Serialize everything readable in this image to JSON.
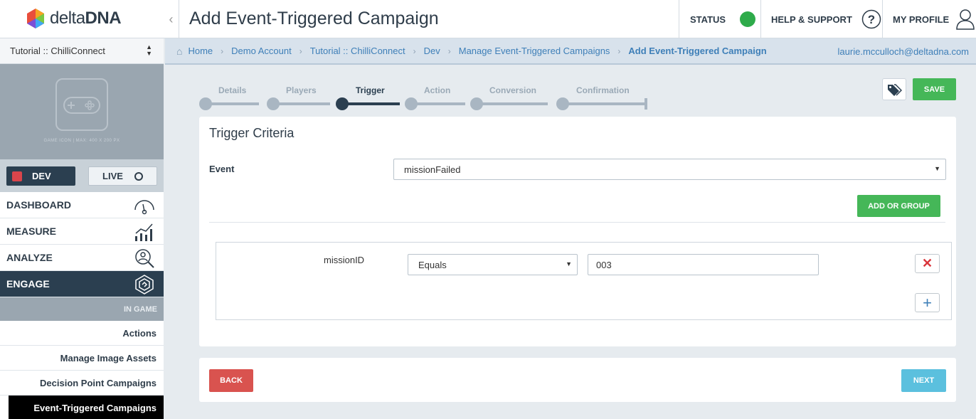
{
  "app": {
    "logo_bold": "delta",
    "logo_brand": "DNA",
    "page_title": "Add Event-Triggered Campaign"
  },
  "header": {
    "status_label": "STATUS",
    "status_color": "#2eab4a",
    "help_label": "HELP & SUPPORT",
    "profile_label": "MY PROFILE"
  },
  "sidebar": {
    "game_select": "Tutorial :: ChilliConnect",
    "game_icon_caption": "GAME ICON  |  MAX: 400 X 200 PX",
    "env_dev": "DEV",
    "env_live": "LIVE",
    "nav": [
      {
        "label": "DASHBOARD",
        "icon": "gauge-icon"
      },
      {
        "label": "MEASURE",
        "icon": "chart-icon"
      },
      {
        "label": "ANALYZE",
        "icon": "magnifier-user-icon"
      },
      {
        "label": "ENGAGE",
        "icon": "engage-icon"
      }
    ],
    "sub_header": "IN GAME",
    "sub_items": [
      "Actions",
      "Manage Image Assets",
      "Decision Point Campaigns",
      "Event-Triggered Campaigns"
    ]
  },
  "breadcrumb": {
    "items": [
      "Home",
      "Demo Account",
      "Tutorial :: ChilliConnect",
      "Dev",
      "Manage Event-Triggered Campaigns"
    ],
    "current": "Add Event-Triggered Campaign",
    "user_email": "laurie.mcculloch@deltadna.com"
  },
  "wizard": {
    "steps": [
      "Details",
      "Players",
      "Trigger",
      "Action",
      "Conversion",
      "Confirmation"
    ],
    "current_step": "Trigger",
    "save_label": "SAVE"
  },
  "trigger": {
    "title": "Trigger Criteria",
    "event_label": "Event",
    "event_value": "missionFailed",
    "add_or_group_label": "ADD OR GROUP",
    "criteria": {
      "param": "missionID",
      "operator": "Equals",
      "value": "003"
    }
  },
  "footer": {
    "back_label": "BACK",
    "next_label": "NEXT"
  },
  "colors": {
    "primary_dark": "#2b3f50",
    "green": "#45b758",
    "red": "#d9534f",
    "blue": "#5bc0de",
    "link": "#3e7fb8"
  }
}
